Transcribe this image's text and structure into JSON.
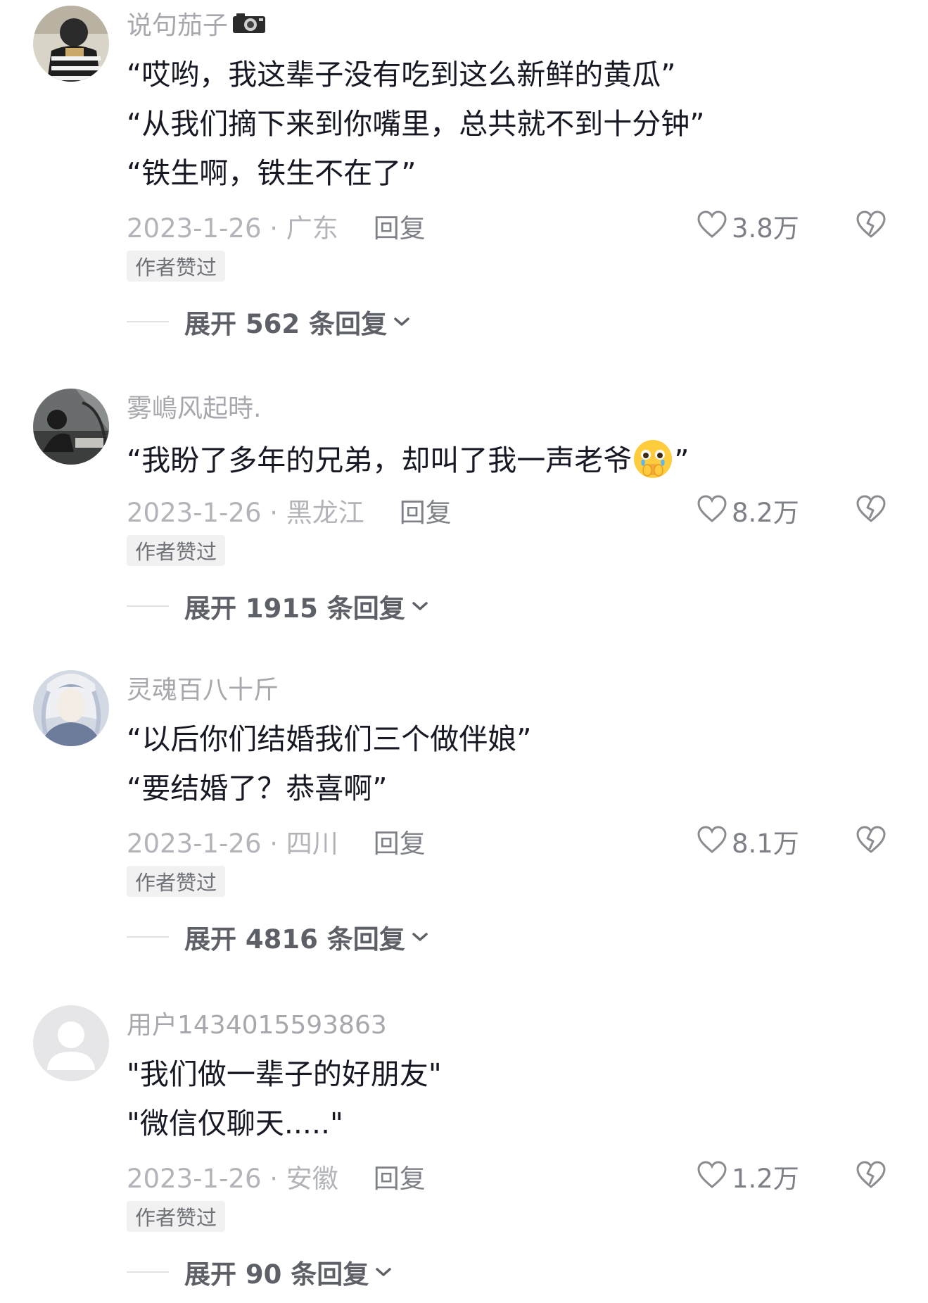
{
  "comments": [
    {
      "username": "说句茄子",
      "username_icon": "camera-icon",
      "lines": [
        "“哎哟，我这辈子没有吃到这么新鲜的黄瓜”",
        "“从我们摘下来到你嘴里，总共就不到十分钟”",
        "“铁生啊，铁生不在了”"
      ],
      "date_location": "2023-1-26 · 广东",
      "reply_label": "回复",
      "likes": "3.8万",
      "badge": "作者赞过",
      "expand_label": "展开 562 条回复",
      "avatar_colors": {
        "bg": "#3a3a3a",
        "accent": "#c9a86a"
      }
    },
    {
      "username": "雾嶋风起時.",
      "lines": [
        "“我盼了多年的兄弟，却叫了我一声老爷",
        "”"
      ],
      "emoji": "crying-face-emoji-icon",
      "date_location": "2023-1-26 · 黑龙江",
      "reply_label": "回复",
      "likes": "8.2万",
      "badge": "作者赞过",
      "expand_label": "展开 1915 条回复",
      "avatar_colors": {
        "bg": "#5b5e5e",
        "accent": "#e9e6df"
      }
    },
    {
      "username": "灵魂百八十斤",
      "lines": [
        "“以后你们结婚我们三个做伴娘”",
        "“要结婚了？恭喜啊”"
      ],
      "date_location": "2023-1-26 · 四川",
      "reply_label": "回复",
      "likes": "8.1万",
      "badge": "作者赞过",
      "expand_label": "展开 4816 条回复",
      "avatar_colors": {
        "bg": "#c7cfdc",
        "accent": "#6c7c9a"
      }
    },
    {
      "username": "用户1434015593863",
      "lines": [
        "\"我们做一辈子的好朋友\"",
        "\"微信仅聊天.....\""
      ],
      "date_location": "2023-1-26 · 安徽",
      "reply_label": "回复",
      "likes": "1.2万",
      "badge": "作者赞过",
      "expand_label": "展开 90 条回复",
      "avatar_colors": {
        "bg": "#e6e6e8",
        "accent": "#ffffff"
      }
    }
  ]
}
